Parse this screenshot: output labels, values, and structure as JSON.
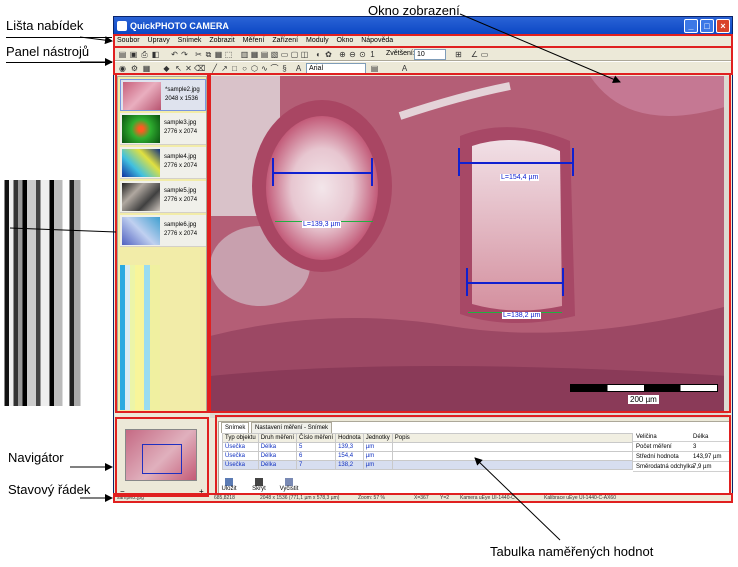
{
  "callouts": {
    "menu_bar": "Lišta nabídek",
    "toolbar": "Panel nástrojů",
    "view_window": "Okno zobrazení",
    "navigator": "Navigátor",
    "status_bar": "Stavový řádek",
    "results_table": "Tabulka naměřených hodnot"
  },
  "window": {
    "title": "QuickPHOTO CAMERA",
    "min": "_",
    "max": "□",
    "close": "×"
  },
  "menu": [
    "Soubor",
    "Úpravy",
    "Snímek",
    "Zobrazit",
    "Měření",
    "Zařízení",
    "Moduly",
    "Okno",
    "Nápověda"
  ],
  "toolbar": {
    "zoom_label": "Zvětšení:",
    "zoom_value": "10",
    "font_value": "Arial"
  },
  "thumbnails": [
    {
      "name": "*sample2.jpg",
      "size": "2048 x 1536"
    },
    {
      "name": "sample3.jpg",
      "size": "2776 x 2074"
    },
    {
      "name": "sample4.jpg",
      "size": "2776 x 2074"
    },
    {
      "name": "sample5.jpg",
      "size": "2776 x 2074"
    },
    {
      "name": "sample6.jpg",
      "size": "2776 x 2074"
    }
  ],
  "image_labels": {
    "measure1": "L=139,3 µm",
    "measure2": "L=154,4 µm",
    "measure3": "L=138,2 µm",
    "scale": "200 µm"
  },
  "results": {
    "tabs": [
      "Snímek",
      "Nastavení měření - Snímek"
    ],
    "columns": [
      "Typ objektu",
      "Druh měření",
      "Číslo měření",
      "Hodnota",
      "Jednotky",
      "Popis"
    ],
    "rows": [
      [
        "Úsečka",
        "Délka",
        "5",
        "139,3",
        "µm",
        ""
      ],
      [
        "Úsečka",
        "Délka",
        "6",
        "154,4",
        "µm",
        ""
      ],
      [
        "Úsečka",
        "Délka",
        "7",
        "138,2",
        "µm",
        ""
      ]
    ],
    "stats": [
      {
        "label": "Veličina",
        "value": "Délka"
      },
      {
        "label": "Počet měření",
        "value": "3"
      },
      {
        "label": "Střední hodnota",
        "value": "143,97 µm"
      },
      {
        "label": "Směrodatná odchylka",
        "value": "7,9 µm"
      }
    ],
    "actions": [
      "Uložit",
      "Skrýt",
      "Vyčistit"
    ]
  },
  "status": {
    "file": "sample2.jpg",
    "coords": "685,8218",
    "dims": "2048 x 1536 (771,1 µm x 578,3 µm)",
    "zoom": "Zoom: 57 %",
    "x": "X=367",
    "y": "Y=2",
    "camera": "Kamera uEye UI-1440-C",
    "calibration": "Kalibrace uEye UI-1440-C-AX60"
  },
  "colors": {
    "title_bar": "#0b46c4",
    "highlight_frame": "#e02020",
    "measure_line": "#1020d0",
    "measure_tick": "#20b040",
    "tissue": "#b26277"
  }
}
